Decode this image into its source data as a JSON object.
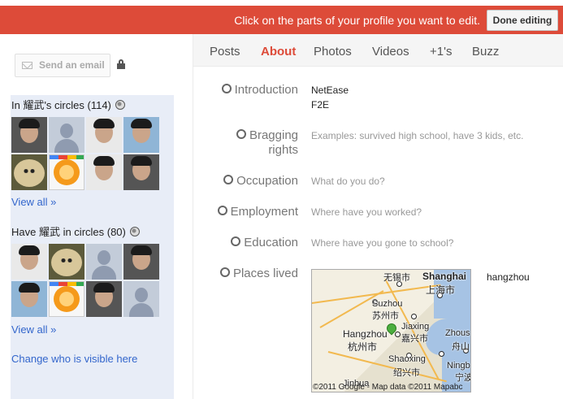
{
  "edit_bar": {
    "message": "Click on the parts of your profile you want to edit.",
    "done_label": "Done editing"
  },
  "sidebar": {
    "send_email_label": "Send an email",
    "in_circles": {
      "title": "In 耀武's circles (114)",
      "view_all": "View all »"
    },
    "have_in_circles": {
      "title": "Have 耀武 in circles (80)",
      "view_all": "View all »"
    },
    "change_visibility": "Change who is visible here"
  },
  "tabs": [
    "Posts",
    "About",
    "Photos",
    "Videos",
    "+1's",
    "Buzz"
  ],
  "active_tab": "About",
  "fields": {
    "introduction": {
      "label": "Introduction",
      "value_line1": "NetEase",
      "value_line2": "F2E"
    },
    "bragging": {
      "label_line1": "Bragging",
      "label_line2": "rights",
      "placeholder": "Examples: survived high school, have 3 kids, etc."
    },
    "occupation": {
      "label": "Occupation",
      "placeholder": "What do you do?"
    },
    "employment": {
      "label": "Employment",
      "placeholder": "Where have you worked?"
    },
    "education": {
      "label": "Education",
      "placeholder": "Where have you gone to school?"
    },
    "places": {
      "label": "Places lived",
      "value": "hangzhou"
    }
  },
  "map": {
    "labels": {
      "wuxi": "无锡市",
      "shanghai_en": "Shanghai",
      "shanghai_zh": "上海市",
      "suzhou_en": "Suzhou",
      "suzhou_zh": "苏州市",
      "jiaxing_en": "Jiaxing",
      "jiaxing_zh": "嘉兴市",
      "hangzhou_en": "Hangzhou",
      "hangzhou_zh": "杭州市",
      "zhoushan_en": "Zhous",
      "zhoushan_zh": "舟山",
      "shaoxing_en": "Shaoxing",
      "shaoxing_zh": "绍兴市",
      "ningbo_en": "Ningb",
      "ningbo_zh": "宁波",
      "jinhua": "Jinhua"
    },
    "copyright": "©2011 Google - Map data ©2011 Mapabc"
  },
  "colors": {
    "edit_bar": "#dd4b39",
    "active_tab": "#dd4b39",
    "link": "#3366cc",
    "panel": "#e8edf7"
  }
}
